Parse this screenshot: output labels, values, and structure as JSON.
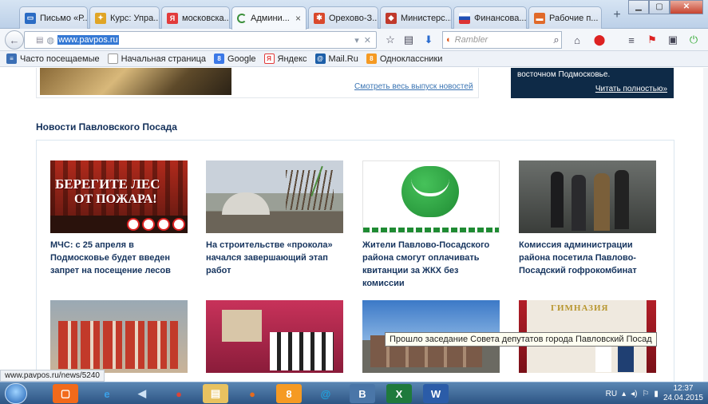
{
  "tabs": [
    {
      "label": "Письмо «Р...",
      "icon": "mail-icon",
      "color": "#2b6cc4"
    },
    {
      "label": "Курс: Упра...",
      "icon": "course-icon",
      "color": "#e0a526"
    },
    {
      "label": "московска...",
      "icon": "yandex-icon",
      "color": "#e23b3b"
    },
    {
      "label": "Админи...",
      "icon": "loading-icon",
      "color": "#3a8f3a",
      "active": true,
      "close": "×"
    },
    {
      "label": "Орехово-З...",
      "icon": "site-icon",
      "color": "#d9482b"
    },
    {
      "label": "Министерс...",
      "icon": "ministry-icon",
      "color": "#c0392b"
    },
    {
      "label": "Финансова...",
      "icon": "flag-icon",
      "color": "#1f4fb5"
    },
    {
      "label": "Рабочие п...",
      "icon": "work-icon",
      "color": "#e06a2a"
    }
  ],
  "newtab_symbol": "+",
  "url": "www.pavpos.ru",
  "search_placeholder": "Rambler",
  "bookmarks": [
    {
      "label": "Часто посещаемые",
      "icon": "bookmarks-icon",
      "color": "#3b6fb5"
    },
    {
      "label": "Начальная страница",
      "icon": "page-icon",
      "color": "#ffffff"
    },
    {
      "label": "Google",
      "icon": "google-icon",
      "color": "#3b78e7"
    },
    {
      "label": "Яндекс",
      "icon": "yandex-icon",
      "color": "#e23b3b"
    },
    {
      "label": "Mail.Ru",
      "icon": "mailru-icon",
      "color": "#1d5fa8"
    },
    {
      "label": "Одноклассники",
      "icon": "ok-icon",
      "color": "#f59a23"
    }
  ],
  "page": {
    "see_all": "Смотреть весь выпуск новостей",
    "navy_text": "восточном Подмосковье.",
    "navy_more": "Читать полностью»",
    "section_title": "Новости Павловского Посада",
    "news": [
      {
        "caption": "МЧС: с 25 апреля в Подмосковье будет введен запрет на посещение лесов",
        "image_text_1": "БЕРЕГИТЕ ЛЕС",
        "image_text_2": "ОТ ПОЖАРА!"
      },
      {
        "caption": "На строительстве «прокола» начался завершающий этап работ"
      },
      {
        "caption": "Жители Павлово-Посадского района смогут оплачивать квитанции за ЖКХ без комиссии"
      },
      {
        "caption": "Комиссия администрации района посетила Павлово-Посадский гофрокомбинат"
      },
      {
        "caption": ""
      },
      {
        "caption": ""
      },
      {
        "caption": ""
      },
      {
        "caption": "",
        "image_text": "ГИМНАЗИЯ"
      }
    ],
    "tooltip": "Прошло заседание Совета депутатов города Павловский Посад",
    "status_url": "www.pavpos.ru/news/5240"
  },
  "taskbar": {
    "lang": "RU",
    "time": "12:37",
    "date": "24.04.2015",
    "apps": [
      {
        "name": "media-icon",
        "color": "#f26a1b",
        "glyph": "▢"
      },
      {
        "name": "ie-icon",
        "color": "#3aa0e8",
        "glyph": "e"
      },
      {
        "name": "player-icon",
        "color": "#5e9ad6",
        "glyph": "◀"
      },
      {
        "name": "chrome-icon",
        "color": "#db4437",
        "glyph": "●"
      },
      {
        "name": "folder-icon",
        "color": "#e8c260",
        "glyph": "▤"
      },
      {
        "name": "firefox-icon",
        "color": "#e66b1e",
        "glyph": "●"
      },
      {
        "name": "ok-icon",
        "color": "#f59a23",
        "glyph": "8"
      },
      {
        "name": "mail-agent-icon",
        "color": "#1fa3df",
        "glyph": "@"
      },
      {
        "name": "vk-icon",
        "color": "#4a76a8",
        "glyph": "B"
      },
      {
        "name": "excel-icon",
        "color": "#1f7a3c",
        "glyph": "X"
      },
      {
        "name": "word-icon",
        "color": "#2b5ca8",
        "glyph": "W"
      }
    ]
  }
}
